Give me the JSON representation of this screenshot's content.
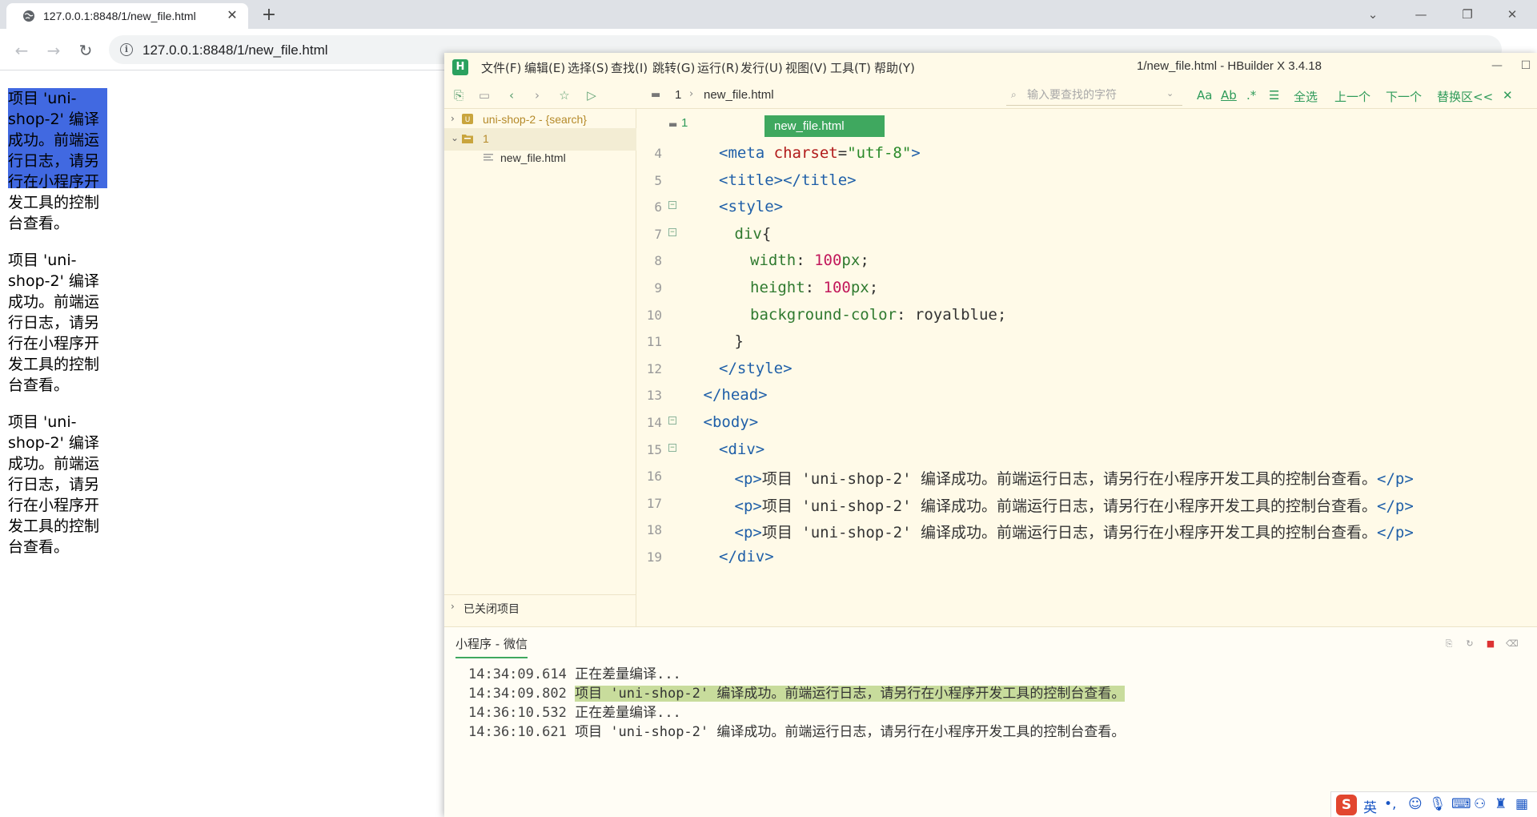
{
  "browser": {
    "tab_title": "127.0.0.1:8848/1/new_file.html",
    "url": "127.0.0.1:8848/1/new_file.html"
  },
  "page": {
    "paragraphs": [
      "项目 'uni-shop-2' 编译成功。前端运行日志，请另行在小程序开发工具的控制台查看。",
      "项目 'uni-shop-2' 编译成功。前端运行日志，请另行在小程序开发工具的控制台查看。",
      "项目 'uni-shop-2' 编译成功。前端运行日志，请另行在小程序开发工具的控制台查看。"
    ]
  },
  "hbuilder": {
    "title": "1/new_file.html - HBuilder X 3.4.18",
    "logo": "H",
    "menu": [
      "文件(F)",
      "编辑(E)",
      "选择(S)",
      "查找(I)",
      "跳转(G)",
      "运行(R)",
      "发行(U)",
      "视图(V)",
      "工具(T)",
      "帮助(Y)"
    ],
    "breadcrumb": {
      "folder": "1",
      "file": "new_file.html"
    },
    "find": {
      "placeholder": "输入要查找的字符",
      "opt_case": "Aa",
      "opt_word": "Ab",
      "opt_regex": ".*",
      "select_all": "全选",
      "prev": "上一个",
      "next": "下一个",
      "replace": "替换区<<"
    },
    "sidebar": {
      "project": "uni-shop-2 - {search}",
      "folder": "1",
      "file": "new_file.html",
      "closed": "已关闭项目"
    },
    "editor": {
      "folder": "1",
      "tab": "new_file.html",
      "lines": [
        {
          "n": "4",
          "code": "<meta charset=\"utf-8\">"
        },
        {
          "n": "5",
          "code": "<title></title>"
        },
        {
          "n": "6",
          "code": "<style>"
        },
        {
          "n": "7",
          "code": "div{"
        },
        {
          "n": "8",
          "code": "width: 100px;"
        },
        {
          "n": "9",
          "code": "height: 100px;"
        },
        {
          "n": "10",
          "code": "background-color: royalblue;"
        },
        {
          "n": "11",
          "code": "}"
        },
        {
          "n": "12",
          "code": "</style>"
        },
        {
          "n": "13",
          "code": "</head>"
        },
        {
          "n": "14",
          "code": "<body>"
        },
        {
          "n": "15",
          "code": "<div>"
        },
        {
          "n": "16",
          "code": "<p>项目 'uni-shop-2' 编译成功。前端运行日志，请另行在小程序开发工具的控制台查看。</p>"
        },
        {
          "n": "17",
          "code": "<p>项目 'uni-shop-2' 编译成功。前端运行日志，请另行在小程序开发工具的控制台查看。</p>"
        },
        {
          "n": "18",
          "code": "<p>项目 'uni-shop-2' 编译成功。前端运行日志，请另行在小程序开发工具的控制台查看。</p>"
        },
        {
          "n": "19",
          "code": "</div>"
        }
      ]
    },
    "console": {
      "tab": "小程序 - 微信",
      "logs": [
        {
          "ts": "14:34:09.614",
          "msg": "正在差量编译..."
        },
        {
          "ts": "14:34:09.802",
          "msg": "项目 'uni-shop-2' 编译成功。前端运行日志，请另行在小程序开发工具的控制台查看。"
        },
        {
          "ts": "14:36:10.532",
          "msg": "正在差量编译..."
        },
        {
          "ts": "14:36:10.621",
          "msg": "项目 'uni-shop-2' 编译成功。前端运行日志，请另行在小程序开发工具的控制台查看。"
        }
      ]
    }
  },
  "ime": {
    "logo": "S",
    "lang": "英"
  },
  "colors": {
    "accent_green": "#3fa85f",
    "selection_blue": "#4169e1",
    "editor_bg": "#fffae8",
    "log_highlight": "#c8dc9c"
  }
}
